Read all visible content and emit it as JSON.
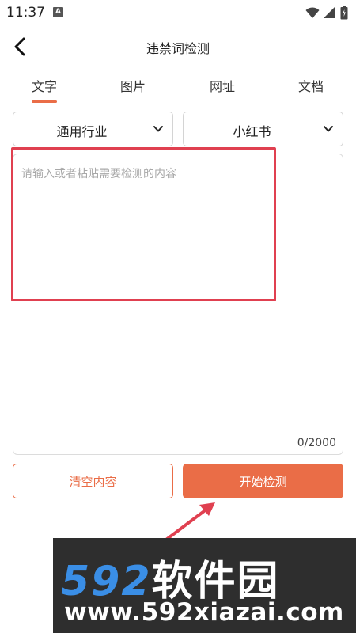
{
  "status_bar": {
    "time": "11:37",
    "notification_glyph": "A"
  },
  "header": {
    "title": "违禁词检测",
    "back_icon": "chevron-left-icon"
  },
  "tabs": [
    {
      "label": "文字",
      "active": true
    },
    {
      "label": "图片",
      "active": false
    },
    {
      "label": "网址",
      "active": false
    },
    {
      "label": "文档",
      "active": false
    }
  ],
  "filters": {
    "industry": {
      "selected": "通用行业"
    },
    "platform": {
      "selected": "小红书"
    }
  },
  "editor": {
    "placeholder": "请输入或者粘贴需要检测的内容",
    "char_count": "0/2000"
  },
  "actions": {
    "clear_label": "清空内容",
    "start_label": "开始检测"
  },
  "watermark": {
    "brand_digits": "592",
    "brand_text": "软件园",
    "url": "www.592xiazai.com"
  },
  "colors": {
    "accent": "#ea6d47",
    "highlight": "#e04050",
    "watermark_blue": "#3a8ee6",
    "watermark_bg": "#2e2e2e"
  }
}
